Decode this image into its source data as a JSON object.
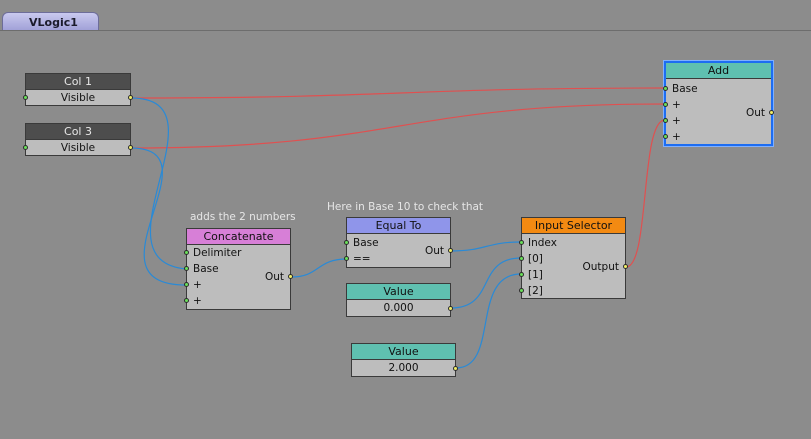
{
  "tabs": [
    {
      "label": "VLogic1"
    }
  ],
  "nodes": {
    "col1": {
      "title": "Col 1",
      "outputs": [
        "Visible"
      ]
    },
    "col3": {
      "title": "Col 3",
      "outputs": [
        "Visible"
      ]
    },
    "add": {
      "title": "Add",
      "inputs": [
        "Base",
        "+",
        "+",
        "+"
      ],
      "output": "Out"
    },
    "concatenate": {
      "title": "Concatenate",
      "comment": "adds the 2 numbers",
      "inputs": [
        "Delimiter",
        "Base",
        "+",
        "+"
      ],
      "output": "Out"
    },
    "equal_to": {
      "title": "Equal To",
      "comment": "Here in Base 10 to check that",
      "inputs": [
        "Base",
        "=="
      ],
      "output": "Out"
    },
    "input_selector": {
      "title": "Input Selector",
      "inputs": [
        "Index",
        "[0]",
        "[1]",
        "[2]"
      ],
      "output": "Output"
    },
    "value1": {
      "title": "Value",
      "value": "0.000"
    },
    "value2": {
      "title": "Value",
      "value": "2.000"
    }
  },
  "colors": {
    "canvas": "#8c8c8c",
    "wire_red": "#e05050",
    "wire_blue": "#2a8ad6",
    "selection": "#1d6df2",
    "header_teal": "#5fc0b0",
    "header_pink": "#d77fd7",
    "header_blue": "#8f95ea",
    "header_orange": "#f38a12",
    "header_dark": "#4d4d4d"
  }
}
